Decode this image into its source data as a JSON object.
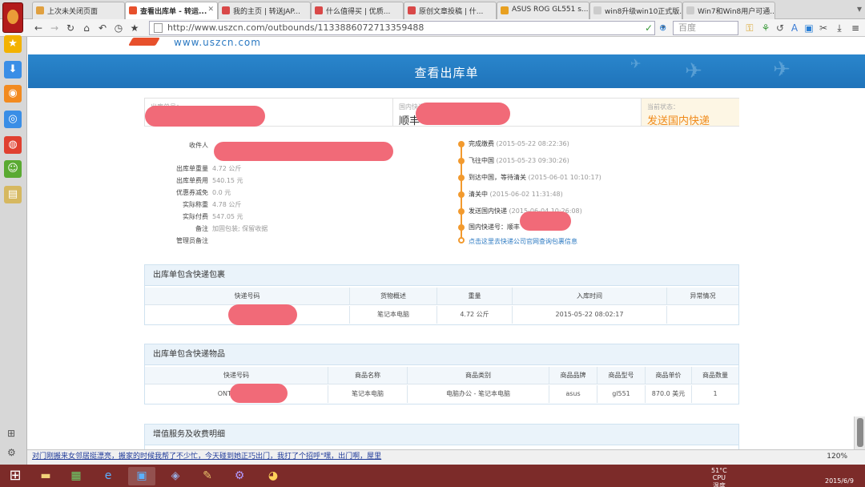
{
  "browser": {
    "tabs": [
      {
        "label": "上次未关闭页面",
        "favicon": "#e0a040"
      },
      {
        "label": "查看出库单 - 转运...",
        "favicon": "#e7502c"
      },
      {
        "label": "我的主页 | 转送JAP...",
        "favicon": "#d94848"
      },
      {
        "label": "什么值得买 | 优质...",
        "favicon": "#d94848"
      },
      {
        "label": "原创文章投稿 | 什...",
        "favicon": "#d94848"
      },
      {
        "label": "ASUS ROG GL551 s...",
        "favicon": "#e8a020"
      },
      {
        "label": "win8升级win10正式版...",
        "favicon": "#cccccc"
      },
      {
        "label": "Win7和Win8用户可通...",
        "favicon": "#cccccc"
      }
    ],
    "address": "http://www.uszcn.com/outbounds/1133886072713359488",
    "search_placeholder": "百度"
  },
  "page": {
    "logo_url": "www.uszcn.com",
    "title": "查看出库单",
    "summary": {
      "outbound_no_label": "出库单号：",
      "domestic_label": "国内快递号",
      "domestic_value": "顺丰",
      "status_label": "当前状态：",
      "status_value": "发送国内快递"
    },
    "details": [
      {
        "label": "收件人",
        "value": ""
      },
      {
        "label": "出库单重量",
        "value": "4.72 公斤"
      },
      {
        "label": "出库单费用",
        "value": "540.15 元"
      },
      {
        "label": "优惠券减免",
        "value": "0.0 元"
      },
      {
        "label": "实际称重",
        "value": "4.78 公斤"
      },
      {
        "label": "实际付费",
        "value": "547.05 元"
      },
      {
        "label": "备注",
        "value": "加固包装; 保留收据"
      },
      {
        "label": "管理员备注",
        "value": ""
      }
    ],
    "timeline": [
      {
        "event": "完成缴费",
        "time": "(2015-05-22 08:22:36)"
      },
      {
        "event": "飞往中国",
        "time": "(2015-05-23 09:30:26)"
      },
      {
        "event": "到达中国，等待清关",
        "time": "(2015-06-01 10:10:17)"
      },
      {
        "event": "清关中",
        "time": "(2015-06-02 11:31:48)"
      },
      {
        "event": "发送国内快递",
        "time": "(2015-06-04 10:26:08)"
      },
      {
        "event": "国内快递号：顺丰",
        "time": ""
      }
    ],
    "timeline_link": "点击这里去快递公司官网查询包裹信息",
    "packages": {
      "title": "出库单包含快递包裹",
      "headers": [
        "快递号码",
        "货物概述",
        "重量",
        "入库时间",
        "异常情况"
      ],
      "rows": [
        [
          "ONTRA",
          "笔记本电脑",
          "4.72 公斤",
          "2015-05-22 08:02:17",
          ""
        ]
      ]
    },
    "items": {
      "title": "出库单包含快递物品",
      "headers": [
        "快递号码",
        "商品名称",
        "商品类别",
        "商品品牌",
        "商品型号",
        "商品单价",
        "商品数量"
      ],
      "rows": [
        [
          "ONTRAC C1",
          "笔记本电脑",
          "电脑办公 - 笔记本电脑",
          "asus",
          "gl551",
          "870.0 美元",
          "1"
        ]
      ]
    },
    "services": {
      "title": "增值服务及收费明细"
    }
  },
  "status_bar": {
    "text": "对门刚搬来女邻居挺漂亮，搬家的时候我帮了不少忙，今天碰到她正巧出门，我打了个招呼\"嘿，出门啊，屋里",
    "zoom": "120%"
  },
  "taskbar": {
    "temp": "51°C",
    "temp_label": "CPU温度",
    "date": "2015/6/9"
  }
}
